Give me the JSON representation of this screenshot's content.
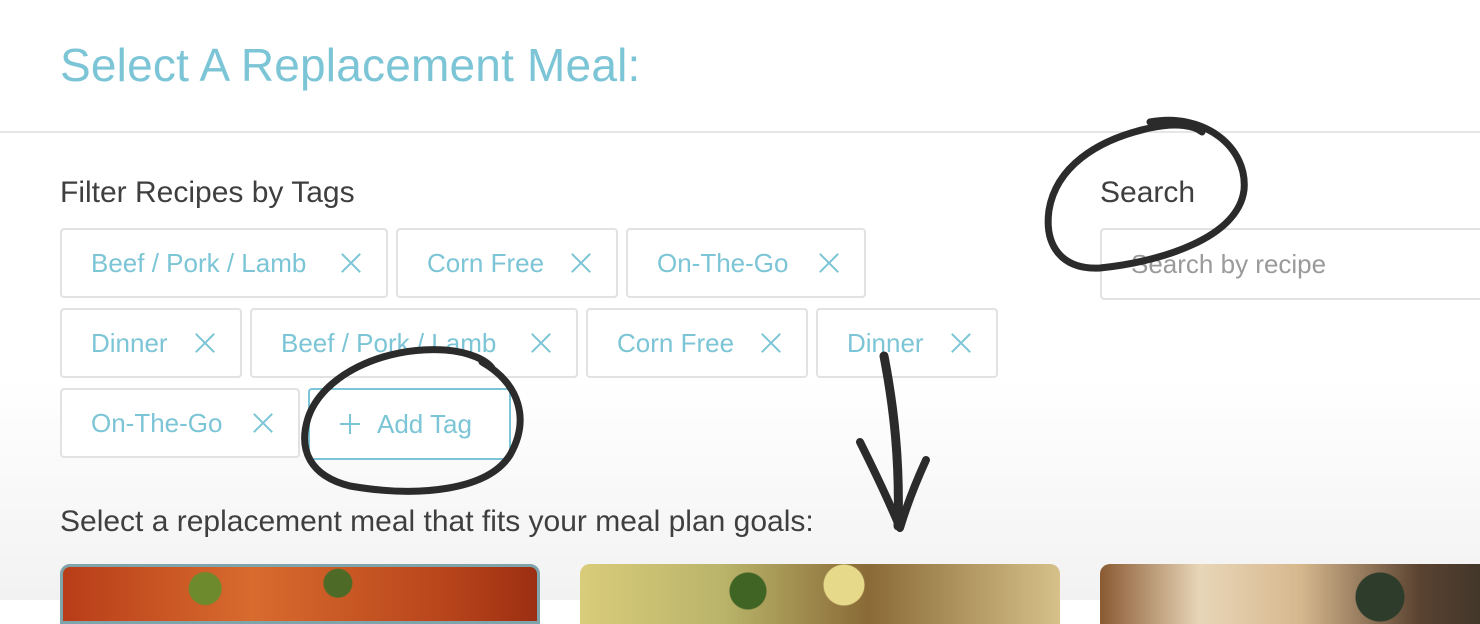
{
  "header": {
    "title": "Select A Replacement Meal:"
  },
  "filter": {
    "label": "Filter Recipes by Tags",
    "tags": [
      {
        "label": "Beef / Pork / Lamb"
      },
      {
        "label": "Corn Free"
      },
      {
        "label": "On-The-Go"
      },
      {
        "label": "Dinner"
      },
      {
        "label": "Beef / Pork / Lamb"
      },
      {
        "label": "Corn Free"
      },
      {
        "label": "Dinner"
      },
      {
        "label": "On-The-Go"
      }
    ],
    "add_tag_label": "Add Tag"
  },
  "search": {
    "label": "Search",
    "placeholder": "Search by recipe",
    "value": ""
  },
  "results": {
    "label": "Select a replacement meal that fits your meal plan goals:",
    "cards": [
      {
        "selected": true
      },
      {
        "selected": false
      },
      {
        "selected": false
      }
    ]
  },
  "colors": {
    "accent": "#7cc5d6",
    "border": "#e2e2e2",
    "text": "#3f3f3f",
    "annotation": "#2b2b2b"
  },
  "icons": {
    "remove_tag": "close-icon",
    "add_tag": "plus-icon"
  }
}
